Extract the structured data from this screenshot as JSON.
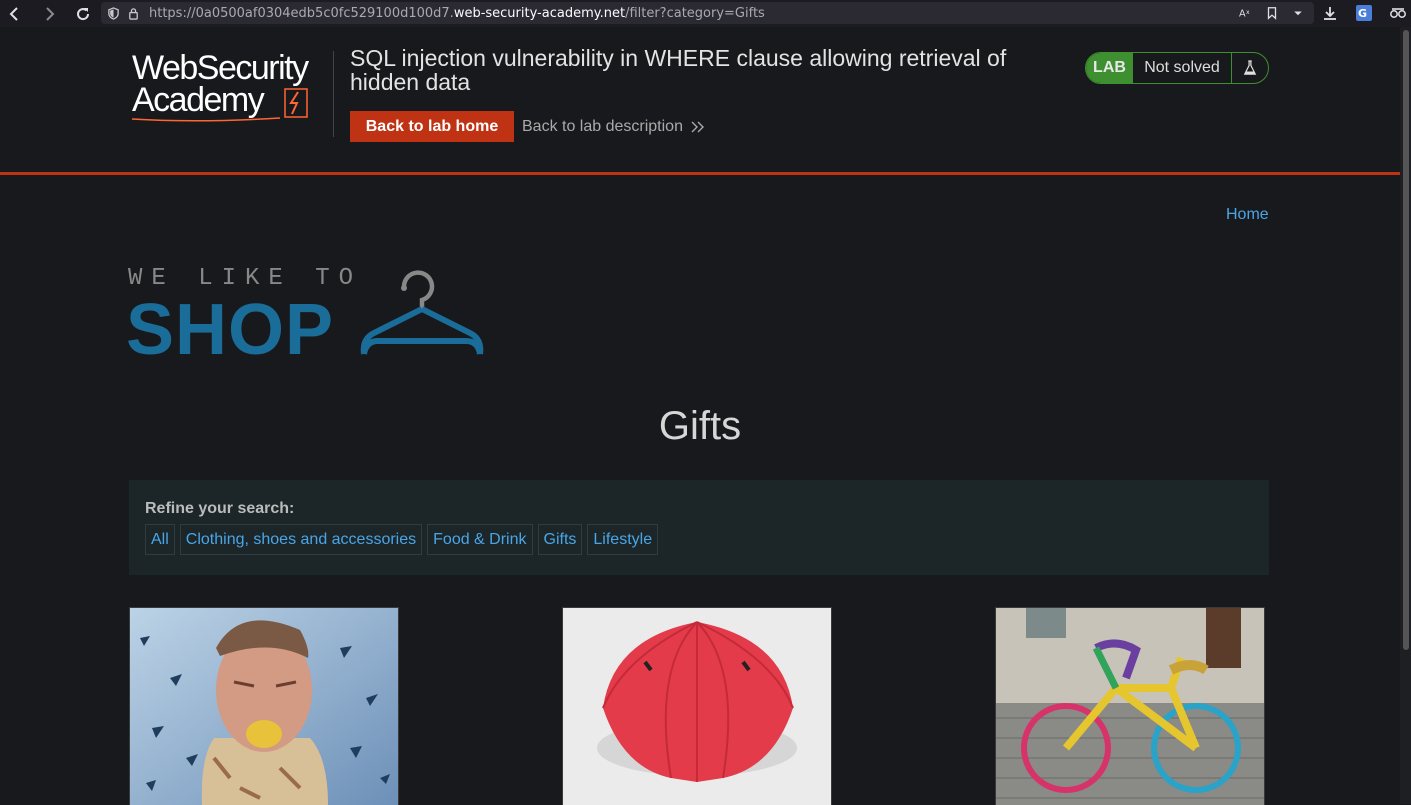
{
  "browser": {
    "url_prefix": "https://0a0500af0304edb5c0fc529100d100d7.",
    "url_host": "web-security-academy.net",
    "url_path": "/filter?category=Gifts"
  },
  "lab": {
    "logo_line1": "WebSecurity",
    "logo_line2": "Academy",
    "title": "SQL injection vulnerability in WHERE clause allowing retrieval of hidden data",
    "back_home": "Back to lab home",
    "back_description": "Back to lab description",
    "badge": "LAB",
    "status": "Not solved",
    "colors": {
      "accent": "#bf3314",
      "status_green": "#3e8f2f"
    }
  },
  "shop": {
    "home_link": "Home",
    "logo_top": "WE LIKE TO",
    "logo_main": "SHOP",
    "category_heading": "Gifts",
    "filter_label": "Refine your search:",
    "filters": [
      "All",
      "Clothing, shoes and accessories",
      "Food & Drink",
      "Gifts",
      "Lifestyle"
    ],
    "link_color": "#4aa5e6",
    "products": [
      {
        "image": "man-biting-lemon"
      },
      {
        "image": "red-umbrella"
      },
      {
        "image": "yarn-bombed-bicycle"
      }
    ]
  }
}
